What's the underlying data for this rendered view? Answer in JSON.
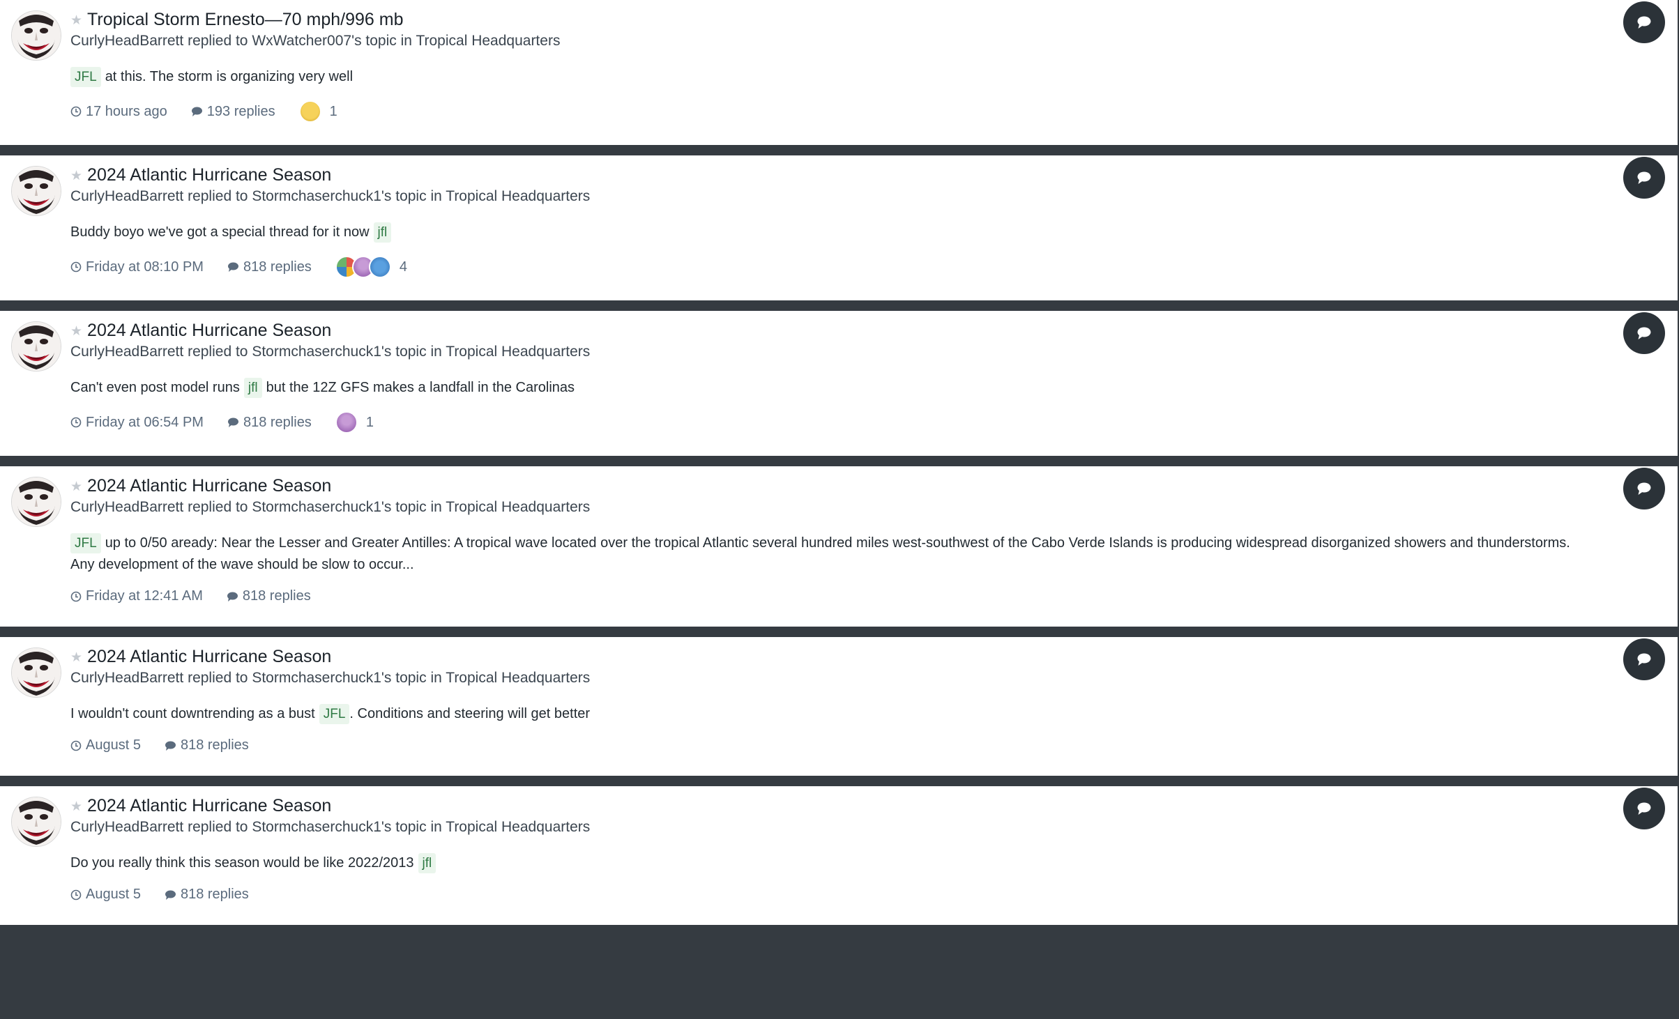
{
  "activity": [
    {
      "title": "Tropical Storm Ernesto—70 mph/996 mb",
      "author": "CurlyHeadBarrett",
      "action": "replied to",
      "topic_owner": "WxWatcher007's topic",
      "in_word": "in",
      "forum": "Tropical Headquarters",
      "snippet_before": "",
      "tag": "JFL",
      "snippet_after": "at this. The storm is organizing very well",
      "time": "17 hours ago",
      "replies": "193 replies",
      "reaction_count": "1",
      "reaction_icons": [
        "confused-face"
      ]
    },
    {
      "title": "2024 Atlantic Hurricane Season",
      "author": "CurlyHeadBarrett",
      "action": "replied to",
      "topic_owner": "Stormchaserchuck1's topic",
      "in_word": "in",
      "forum": "Tropical Headquarters",
      "snippet_before": "Buddy boyo we've got a special thread for it now",
      "tag": "jfl",
      "snippet_after": "",
      "time": "Friday at 08:10 PM",
      "replies": "818 replies",
      "reaction_count": "4",
      "reaction_icons": [
        "crayons",
        "trophy",
        "heart"
      ]
    },
    {
      "title": "2024 Atlantic Hurricane Season",
      "author": "CurlyHeadBarrett",
      "action": "replied to",
      "topic_owner": "Stormchaserchuck1's topic",
      "in_word": "in",
      "forum": "Tropical Headquarters",
      "snippet_before": "Can't even post model runs",
      "tag": "jfl",
      "snippet_after": "but the 12Z GFS makes a landfall in the Carolinas",
      "time": "Friday at 06:54 PM",
      "replies": "818 replies",
      "reaction_count": "1",
      "reaction_icons": [
        "trophy"
      ]
    },
    {
      "title": "2024 Atlantic Hurricane Season",
      "author": "CurlyHeadBarrett",
      "action": "replied to",
      "topic_owner": "Stormchaserchuck1's topic",
      "in_word": "in",
      "forum": "Tropical Headquarters",
      "snippet_before": "",
      "tag": "JFL",
      "snippet_after": "up to 0/50 aready: Near the Lesser and Greater Antilles: A tropical wave located over the tropical Atlantic several hundred miles west-southwest of the Cabo Verde Islands is producing widespread disorganized showers and thunderstorms. Any development of the wave should be slow to occur...",
      "time": "Friday at 12:41 AM",
      "replies": "818 replies",
      "reaction_count": "",
      "reaction_icons": []
    },
    {
      "title": "2024 Atlantic Hurricane Season",
      "author": "CurlyHeadBarrett",
      "action": "replied to",
      "topic_owner": "Stormchaserchuck1's topic",
      "in_word": "in",
      "forum": "Tropical Headquarters",
      "snippet_before": "I wouldn't count downtrending as a bust",
      "tag": "JFL",
      "snippet_after": ". Conditions and steering will get better",
      "time": "August 5",
      "replies": "818 replies",
      "reaction_count": "",
      "reaction_icons": []
    },
    {
      "title": "2024 Atlantic Hurricane Season",
      "author": "CurlyHeadBarrett",
      "action": "replied to",
      "topic_owner": "Stormchaserchuck1's topic",
      "in_word": "in",
      "forum": "Tropical Headquarters",
      "snippet_before": "Do you really think this season would be like 2022/2013",
      "tag": "jfl",
      "snippet_after": "",
      "time": "August 5",
      "replies": "818 replies",
      "reaction_count": "",
      "reaction_icons": []
    }
  ],
  "colors": {
    "page_background": "#353b41",
    "card_background": "#ffffff",
    "tag_background": "#eaf5ec",
    "tag_text": "#2f7a44",
    "meta_text": "#5b6b7d",
    "reply_button": "#2b3238"
  }
}
